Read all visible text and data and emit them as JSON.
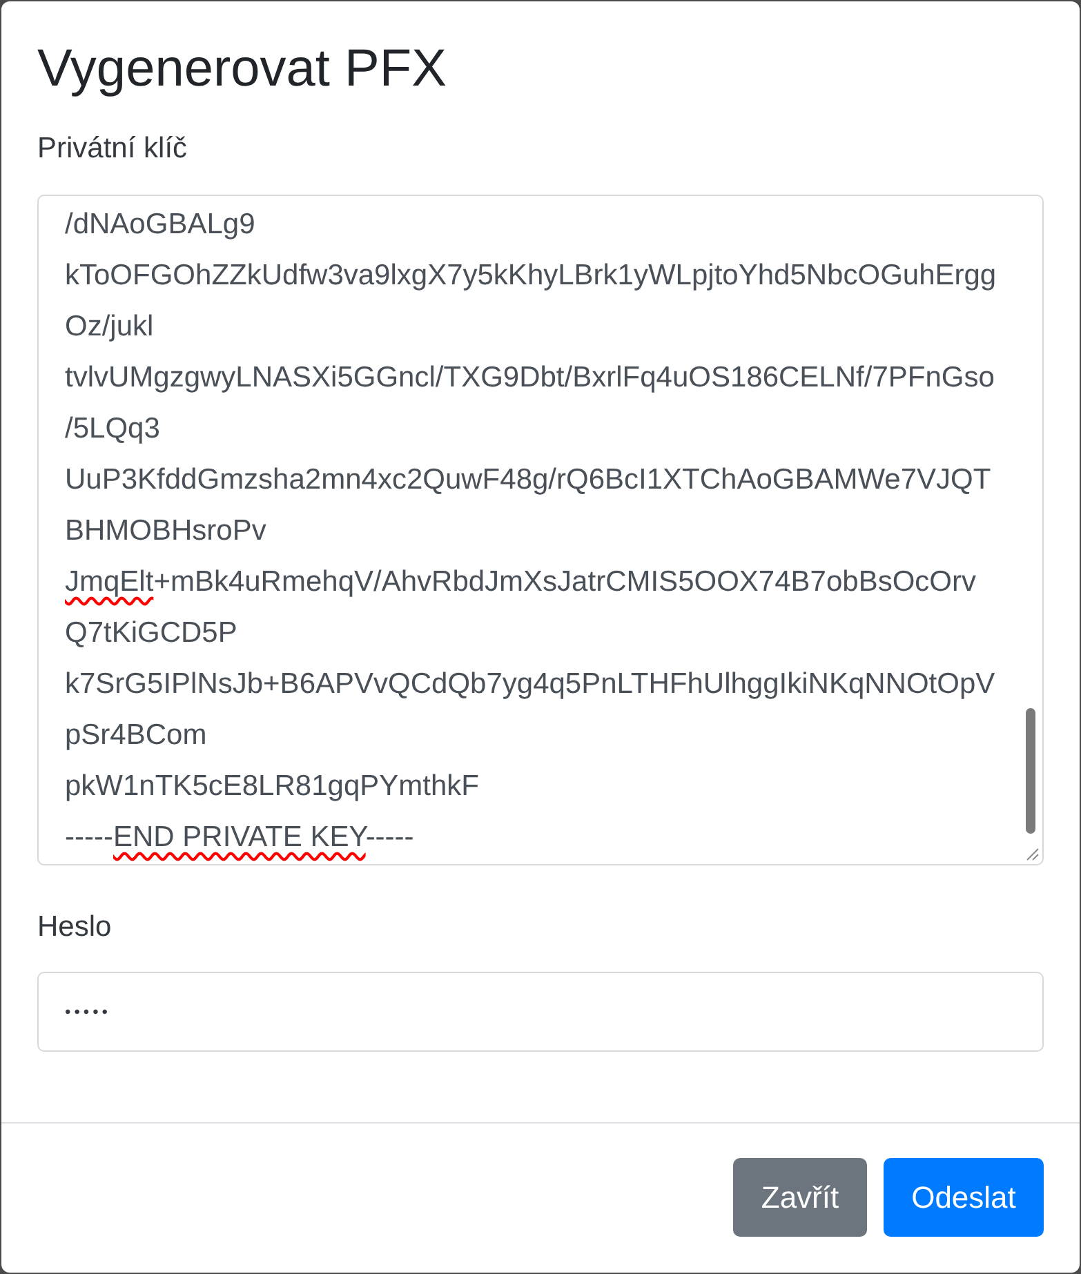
{
  "dialog": {
    "title": "Vygenerovat PFX"
  },
  "private_key": {
    "label": "Privátní klíč",
    "lines": [
      [
        {
          "text": "/dNAoGBALg9",
          "misspelled": false
        }
      ],
      [
        {
          "text": "kToOFGOhZZkUdfw3va9lxgX7y5kKhyLBrk1yWLpjtoYhd5NbcOGuhErgg",
          "misspelled": false
        }
      ],
      [
        {
          "text": "Oz/jukl",
          "misspelled": false
        }
      ],
      [
        {
          "text": "tvlvUMgzgwyLNASXi5GGncl/TXG9Dbt/BxrlFq4uOS186CELNf/7PFnGso",
          "misspelled": false
        }
      ],
      [
        {
          "text": "/5LQq3",
          "misspelled": false
        }
      ],
      [
        {
          "text": "UuP3KfddGmzsha2mn4xc2QuwF48g/rQ6BcI1XTChAoGBAMWe7VJQT",
          "misspelled": false
        }
      ],
      [
        {
          "text": "BHMOBHsroPv",
          "misspelled": false
        }
      ],
      [
        {
          "text": "JmqElt",
          "misspelled": true
        },
        {
          "text": "+mBk4uRmehqV/AhvRbdJmXsJatrCMIS5OOX74B7obBsOcOrv",
          "misspelled": false
        }
      ],
      [
        {
          "text": "Q7tKiGCD5P",
          "misspelled": false
        }
      ],
      [
        {
          "text": "k7SrG5IPlNsJb+B6APVvQCdQb7yg4q5PnLTHFhUlhggIkiNKqNNOtOpV",
          "misspelled": false
        }
      ],
      [
        {
          "text": "pSr4BCom",
          "misspelled": false
        }
      ],
      [
        {
          "text": "pkW1nTK5cE8LR81gqPYmthkF",
          "misspelled": false
        }
      ],
      [
        {
          "text": "-----",
          "misspelled": false
        },
        {
          "text": "END PRIVATE KEY",
          "misspelled": true
        },
        {
          "text": "-----",
          "misspelled": false
        }
      ]
    ]
  },
  "password": {
    "label": "Heslo",
    "value": "•••••"
  },
  "buttons": [
    {
      "label": "Zavřít",
      "kind": "secondary"
    },
    {
      "label": "Odeslat",
      "kind": "primary"
    }
  ]
}
